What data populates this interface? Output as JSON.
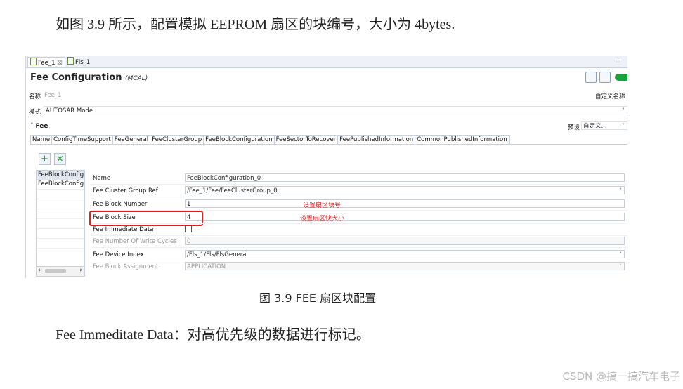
{
  "doc": {
    "intro": "如图 3.9 所示，配置模拟 EEPROM 扇区的块编号，大小为 4bytes.",
    "caption": "图 3.9 FEE 扇区块配置",
    "outro": "Fee Immeditate Data：对高优先级的数据进行标记。",
    "watermark": "CSDN @搞一搞汽车电子"
  },
  "editor_tabs": [
    {
      "label": "Fee_1",
      "close": "☒"
    },
    {
      "label": "Fls_1"
    }
  ],
  "header": {
    "title": "Fee Configuration",
    "subtitle": "(MCAL)"
  },
  "top_fields": {
    "name_label": "名称",
    "name_value": "Fee_1",
    "custom_name_label": "自定义名称",
    "mode_label": "模式",
    "mode_value": "AUTOSAR Mode"
  },
  "section": {
    "title": "Fee",
    "preset_label": "预设",
    "preset_value": "自定义..."
  },
  "config_tabs": [
    "Name",
    "ConfigTimeSupport",
    "FeeGeneral",
    "FeeClusterGroup",
    "FeeBlockConfiguration",
    "FeeSectorToRecover",
    "FeePublishedInformation",
    "CommonPublishedInformation"
  ],
  "list": {
    "items": [
      "FeeBlockConfig",
      "FeeBlockConfig"
    ],
    "scroll_left": "‹",
    "scroll_right": "›"
  },
  "buttons": {
    "add": "+",
    "remove": "×"
  },
  "form": [
    {
      "label": "Name",
      "value": "FeeBlockConfiguration_0"
    },
    {
      "label": "Fee Cluster Group Ref",
      "value": "/Fee_1/Fee/FeeClusterGroup_0"
    },
    {
      "label": "Fee Block Number",
      "value": "1"
    },
    {
      "label": "Fee Block Size",
      "value": "4"
    },
    {
      "label": "Fee Immediate Data",
      "value": ""
    },
    {
      "label": "Fee Number Of Write Cycles",
      "value": "0"
    },
    {
      "label": "Fee Device Index",
      "value": "/Fls_1/Fls/FlsGeneral"
    },
    {
      "label": "Fee Block Assignment",
      "value": "APPLICATION"
    }
  ],
  "annotations": {
    "block_number": "设置扇区块号",
    "block_size": "设置扇区快大小"
  },
  "icons": {
    "chevron": "˅",
    "expand": "˅"
  }
}
